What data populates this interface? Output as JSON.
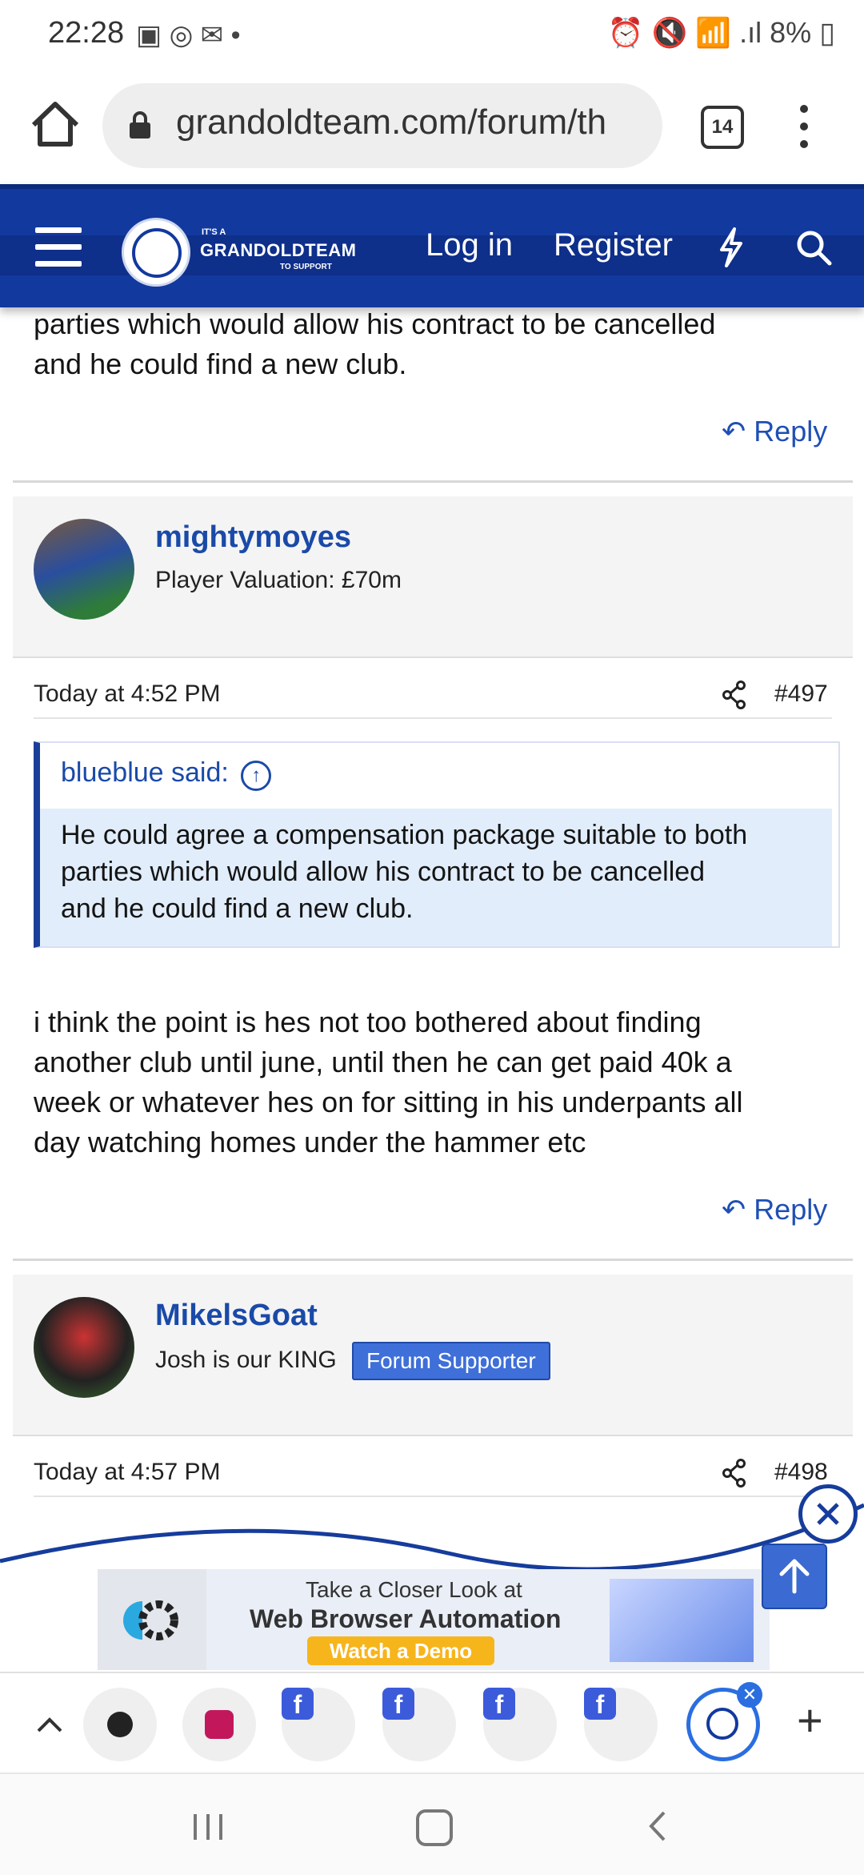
{
  "status_bar": {
    "time": "22:28",
    "icons_left": "▣ ◎ ✉ •",
    "icons_right": "⏰ 🔇 📶 .ıl",
    "battery": "8%"
  },
  "browser": {
    "url": "grandoldteam.com/forum/th",
    "tab_count": "14"
  },
  "site_header": {
    "logo_small": "IT'S A",
    "logo_big": "GRANDOLDTEAM",
    "logo_tag": "TO SUPPORT",
    "login": "Log in",
    "register": "Register"
  },
  "posts": [
    {
      "tail_text_line1": "parties which would allow his contract to be cancelled",
      "tail_text_line2": "and he could find a new club.",
      "reply": "Reply"
    },
    {
      "username": "mightymoyes",
      "user_title": "Player Valuation: £70m",
      "time": "Today at 4:52 PM",
      "number": "#497",
      "quote_author": "blueblue said:",
      "quote_lines": [
        "He could agree a compensation package suitable to both",
        "parties which would allow his contract to be cancelled",
        "and he could find a new club."
      ],
      "body_lines": [
        "i think the point is hes not too bothered about finding",
        "another club until june, until then he can get paid 40k a",
        "week or whatever hes on for sitting in his underpants all",
        "day watching homes under the hammer etc"
      ],
      "reply": "Reply"
    },
    {
      "username": "MikelsGoat",
      "user_title": "Josh is our KING",
      "badge": "Forum Supporter",
      "time": "Today at 4:57 PM",
      "number": "#498"
    }
  ],
  "ad": {
    "line1": "Take a Closer Look at",
    "line2": "Web Browser Automation",
    "cta": "Watch a Demo"
  },
  "tab_strip": {
    "add": "+"
  },
  "colors": {
    "header_blue": "#12399e",
    "link_blue": "#1a4aa8",
    "quote_bg": "#e1edfa",
    "badge_blue": "#3f6fd8"
  }
}
